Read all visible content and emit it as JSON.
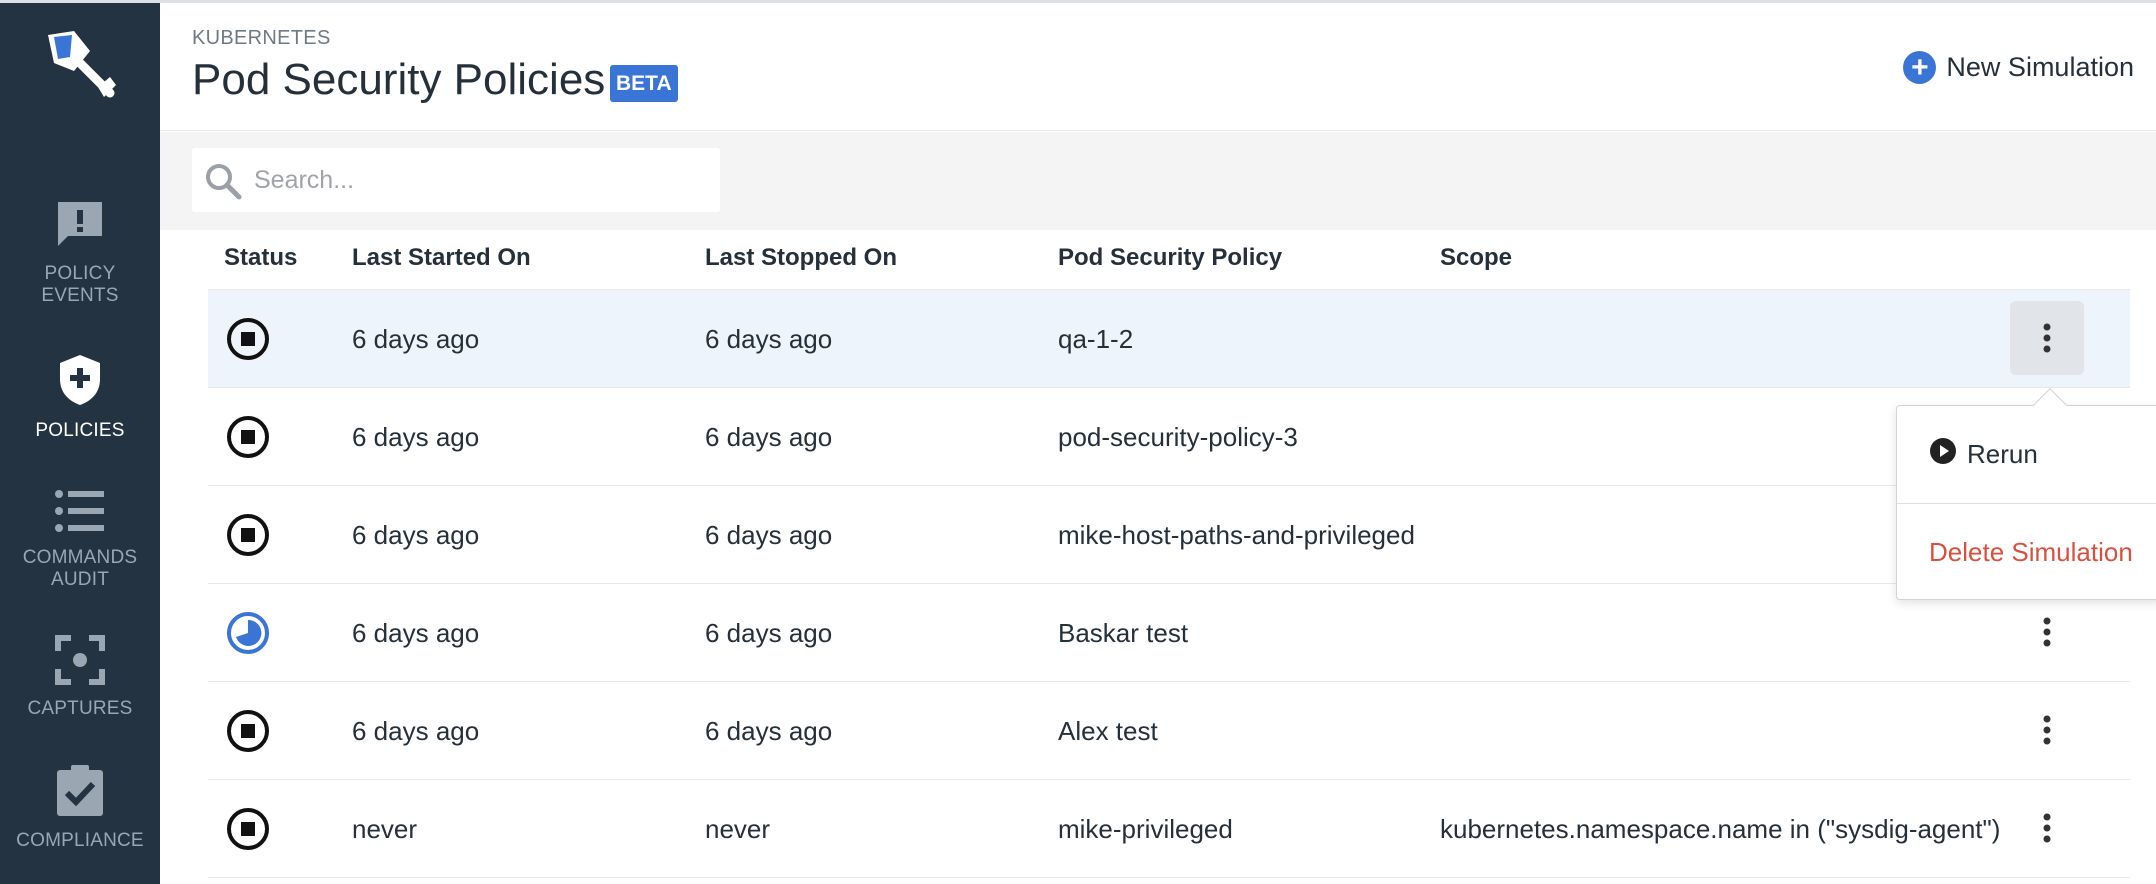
{
  "sidebar": {
    "logo_icon": "shovel-logo-icon",
    "items": [
      {
        "label_line1": "POLICY",
        "label_line2": "EVENTS",
        "icon": "alert-message-icon",
        "active": false
      },
      {
        "label_line1": "POLICIES",
        "label_line2": "",
        "icon": "shield-plus-icon",
        "active": true
      },
      {
        "label_line1": "COMMANDS",
        "label_line2": "AUDIT",
        "icon": "list-icon",
        "active": false
      },
      {
        "label_line1": "CAPTURES",
        "label_line2": "",
        "icon": "capture-focus-icon",
        "active": false
      },
      {
        "label_line1": "COMPLIANCE",
        "label_line2": "",
        "icon": "clipboard-check-icon",
        "active": false
      }
    ]
  },
  "header": {
    "breadcrumb": "KUBERNETES",
    "title": "Pod Security Policies",
    "badge": "BETA",
    "new_simulation_label": "New Simulation"
  },
  "search": {
    "placeholder": "Search..."
  },
  "table": {
    "columns": [
      "Status",
      "Last Started On",
      "Last Stopped On",
      "Pod Security Policy",
      "Scope"
    ],
    "rows": [
      {
        "status": "stopped",
        "started": "6 days ago",
        "stopped": "6 days ago",
        "policy": "qa-1-2",
        "scope": ""
      },
      {
        "status": "stopped",
        "started": "6 days ago",
        "stopped": "6 days ago",
        "policy": "pod-security-policy-3",
        "scope": ""
      },
      {
        "status": "stopped",
        "started": "6 days ago",
        "stopped": "6 days ago",
        "policy": "mike-host-paths-and-privileged",
        "scope": ""
      },
      {
        "status": "running",
        "started": "6 days ago",
        "stopped": "6 days ago",
        "policy": "Baskar test",
        "scope": ""
      },
      {
        "status": "stopped",
        "started": "6 days ago",
        "stopped": "6 days ago",
        "policy": "Alex test",
        "scope": ""
      },
      {
        "status": "stopped",
        "started": "never",
        "stopped": "never",
        "policy": "mike-privileged",
        "scope": "kubernetes.namespace.name in (\"sysdig-agent\")"
      }
    ]
  },
  "menu": {
    "rerun_label": "Rerun",
    "delete_label": "Delete Simulation"
  },
  "colors": {
    "sidebar_bg": "#233342",
    "accent": "#3a75d6",
    "danger": "#d9503f",
    "selected_row": "#edf4fc"
  }
}
